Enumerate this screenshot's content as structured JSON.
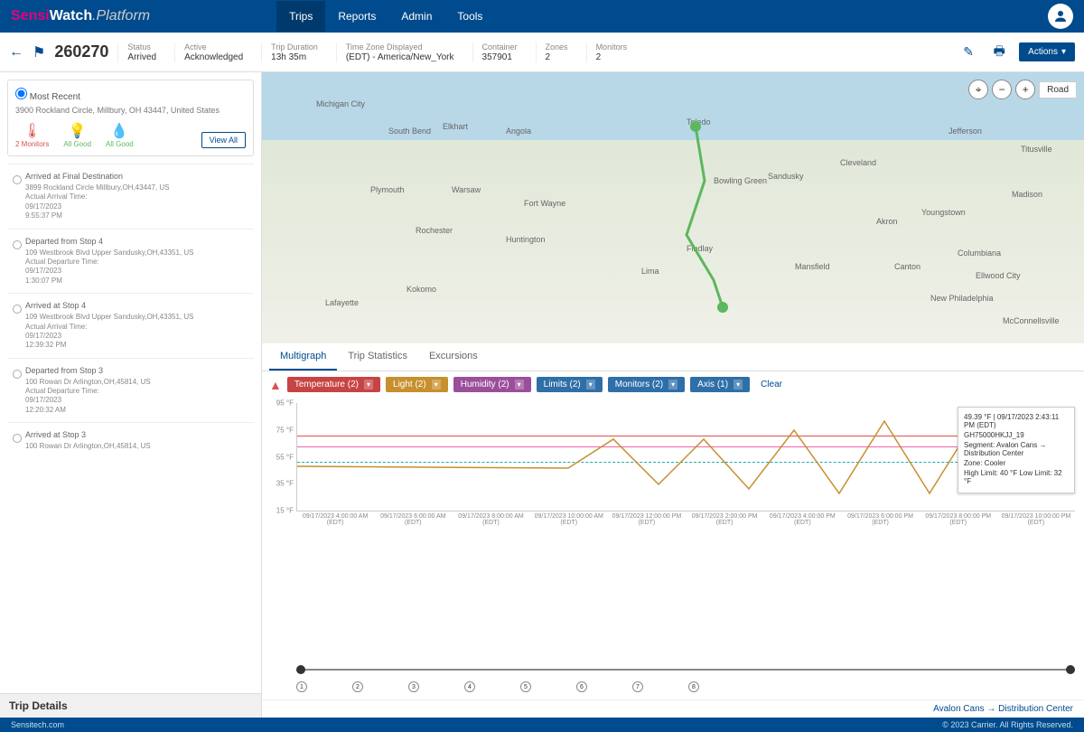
{
  "brand": {
    "sensi": "Sensi",
    "watch": "Watch",
    "platform": ".Platform"
  },
  "nav": {
    "trips": "Trips",
    "reports": "Reports",
    "admin": "Admin",
    "tools": "Tools"
  },
  "trip": {
    "id": "260270",
    "status_label": "Status",
    "status_value": "Arrived",
    "acknowledged_label": "Active",
    "acknowledged_value": "Acknowledged",
    "duration_label": "Trip Duration",
    "duration_value": "13h 35m",
    "tz_label": "Time Zone Displayed",
    "tz_value": "(EDT) - America/New_York",
    "container_label": "Container",
    "container_value": "357901",
    "zones_label": "Zones",
    "zones_value": "2",
    "monitors_label": "Monitors",
    "monitors_value": "2"
  },
  "actions": {
    "actions_label": "Actions"
  },
  "recent": {
    "title": "Most Recent",
    "address": "3900 Rockland Circle, Millbury, OH 43447, United States",
    "temp_label": "2 Monitors",
    "light_label": "All Good",
    "humid_label": "All Good",
    "view_all": "View All"
  },
  "timeline": [
    {
      "title": "Arrived at Final Destination",
      "addr": "3899 Rockland Circle Millbury,OH,43447, US",
      "time_label": "Actual Arrival Time:",
      "date": "09/17/2023",
      "time": "9:55:37 PM"
    },
    {
      "title": "Departed from Stop 4",
      "addr": "109 Westbrook Blvd Upper Sandusky,OH,43351, US",
      "time_label": "Actual Departure Time:",
      "date": "09/17/2023",
      "time": "1:30:07 PM"
    },
    {
      "title": "Arrived at Stop 4",
      "addr": "109 Westbrook Blvd Upper Sandusky,OH,43351, US",
      "time_label": "Actual Arrival Time:",
      "date": "09/17/2023",
      "time": "12:39:32 PM"
    },
    {
      "title": "Departed from Stop 3",
      "addr": "100 Rowan Dr Arlington,OH,45814, US",
      "time_label": "Actual Departure Time:",
      "date": "09/17/2023",
      "time": "12:20:32 AM"
    },
    {
      "title": "Arrived at Stop 3",
      "addr": "100 Rowan Dr Arlington,OH,45814, US",
      "time_label": "",
      "date": "",
      "time": ""
    }
  ],
  "details_header": "Trip Details",
  "map": {
    "road_label": "Road",
    "labels": [
      "Michigan City",
      "South Bend",
      "Elkhart",
      "Angola",
      "Toledo",
      "Cleveland",
      "Fort Wayne",
      "Bowling Green",
      "Sandusky",
      "Akron",
      "Youngstown",
      "Lafayette",
      "Kokomo",
      "Lima",
      "Findlay",
      "Mansfield",
      "Canton",
      "Huntington",
      "Warsaw",
      "Plymouth",
      "Rochester",
      "Columbiana",
      "Jefferson",
      "Titusville",
      "Madison",
      "New Philadelphia",
      "McConnellsville",
      "Ellwood City"
    ]
  },
  "tabs": {
    "multigraph": "Multigraph",
    "stats": "Trip Statistics",
    "excursions": "Excursions"
  },
  "chips": {
    "temperature": "Temperature (2)",
    "light": "Light (2)",
    "humidity": "Humidity (2)",
    "limits": "Limits (2)",
    "monitors": "Monitors (2)",
    "axis": "Axis (1)",
    "clear": "Clear"
  },
  "chart_data": {
    "type": "line",
    "ylabel": "Temperature",
    "ylim": [
      15,
      95
    ],
    "yticks": [
      "95 °F",
      "75 °F",
      "55 °F",
      "35 °F",
      "15 °F"
    ],
    "xticks": [
      "09/17/2023 4:00:00 AM (EDT)",
      "09/17/2023 6:00:00 AM (EDT)",
      "09/17/2023 8:00:00 AM (EDT)",
      "09/17/2023 10:00:00 AM (EDT)",
      "09/17/2023 12:00:00 PM (EDT)",
      "09/17/2023 2:00:00 PM (EDT)",
      "09/17/2023 4:00:00 PM (EDT)",
      "09/17/2023 6:00:00 PM (EDT)",
      "09/17/2023 8:00:00 PM (EDT)",
      "09/17/2023 10:00:00 PM (EDT)"
    ],
    "series": [
      {
        "name": "Zone: Cooler – High Temperature 40 °F",
        "color": "#d9534f",
        "approx_level": 75
      },
      {
        "name": "Zone: Cooler – Low Temperature 32 °F",
        "color": "#2aa",
        "approx_level": 45
      },
      {
        "name": "Light",
        "color": "#c78f2e",
        "approx_level": 50
      }
    ],
    "limits": {
      "high": 40,
      "low": 32,
      "unit": "°F"
    }
  },
  "tooltip": {
    "point": "49.39 °F | 09/17/2023 2:43:11 PM (EDT)",
    "monitor": "GH75000HKJJ_19",
    "segment": "Segment: Avalon Cans → Distribution Center",
    "zone": "Zone: Cooler",
    "limit": "High Limit: 40 °F  Low Limit: 32 °F"
  },
  "route_footer": "Avalon Cans → Distribution Center",
  "footer": {
    "site": "Sensitech.com",
    "copyright": "© 2023 Carrier. All Rights Reserved."
  }
}
